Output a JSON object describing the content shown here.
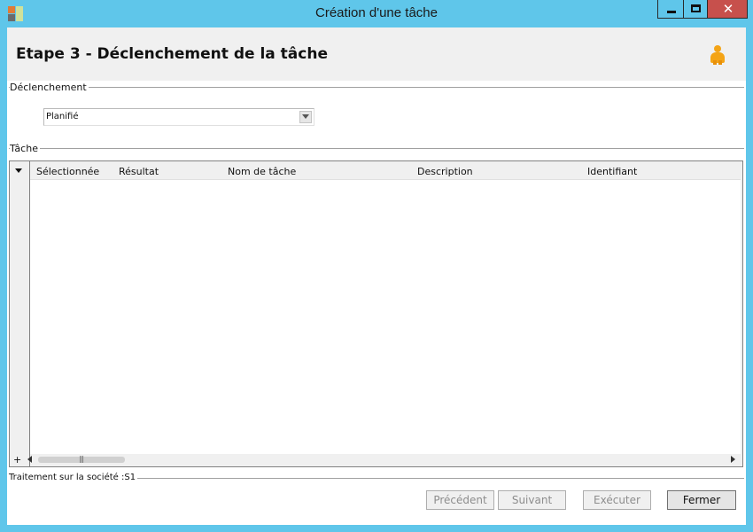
{
  "window": {
    "title": "Création d'une tâche",
    "close_glyph": "✕"
  },
  "header": {
    "step_title": "Etape 3 - Déclenchement de la tâche"
  },
  "trigger_group": {
    "label": "Déclenchement",
    "selected": "Planifié"
  },
  "task_group": {
    "label": "Tâche"
  },
  "grid": {
    "columns": [
      "Sélectionnée",
      "Résultat",
      "Nom de tâche",
      "Description",
      "Identifiant"
    ],
    "rows": [],
    "add_glyph": "+"
  },
  "footer": {
    "label": "Traitement sur la société :S1"
  },
  "buttons": {
    "prev": "Précédent",
    "next": "Suivant",
    "exec": "Exécuter",
    "close": "Fermer"
  },
  "colors": {
    "titlebar": "#5fc6ea",
    "close_button": "#c7504c",
    "user_icon": "#f4a416"
  }
}
